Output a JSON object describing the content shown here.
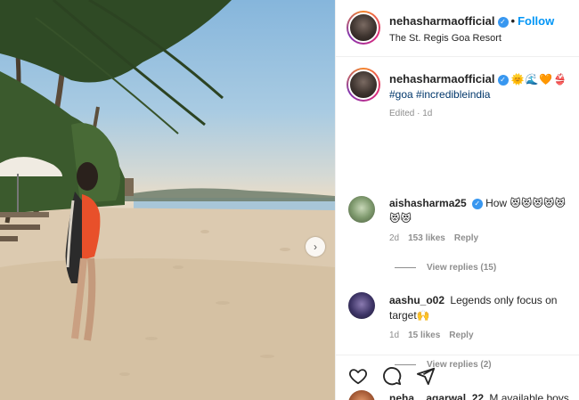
{
  "post": {
    "photo_next": "›"
  },
  "header": {
    "username": "nehasharmaofficial",
    "verified": "✓",
    "dot": "•",
    "follow_label": "Follow",
    "location": "The St. Regis Goa Resort"
  },
  "caption": {
    "username": "nehasharmaofficial",
    "verified": "✓",
    "emoji": "🌞🌊🧡👙",
    "tags": "#goa #incredibleindia",
    "meta": "Edited · 1d"
  },
  "comments": [
    {
      "username": "aishasharma25",
      "verified": "✓",
      "text": "How 😻😻😻😻😻😻😻",
      "age": "2d",
      "likes": "153 likes",
      "reply": "Reply",
      "view_replies": "View replies (15)"
    },
    {
      "username": "aashu_o02",
      "text": "Legends only focus on target🙌",
      "age": "1d",
      "likes": "15 likes",
      "reply": "Reply",
      "view_replies": "View replies (2)"
    },
    {
      "username": "neha__agarwal_22",
      "text": "M available boys"
    }
  ],
  "actions": {
    "like_icon": "heart-icon",
    "comment_icon": "comment-icon",
    "share_icon": "share-icon"
  },
  "colors": {
    "accent": "#0095f6",
    "verified": "#3897f0",
    "muted": "#8e8e8e"
  }
}
